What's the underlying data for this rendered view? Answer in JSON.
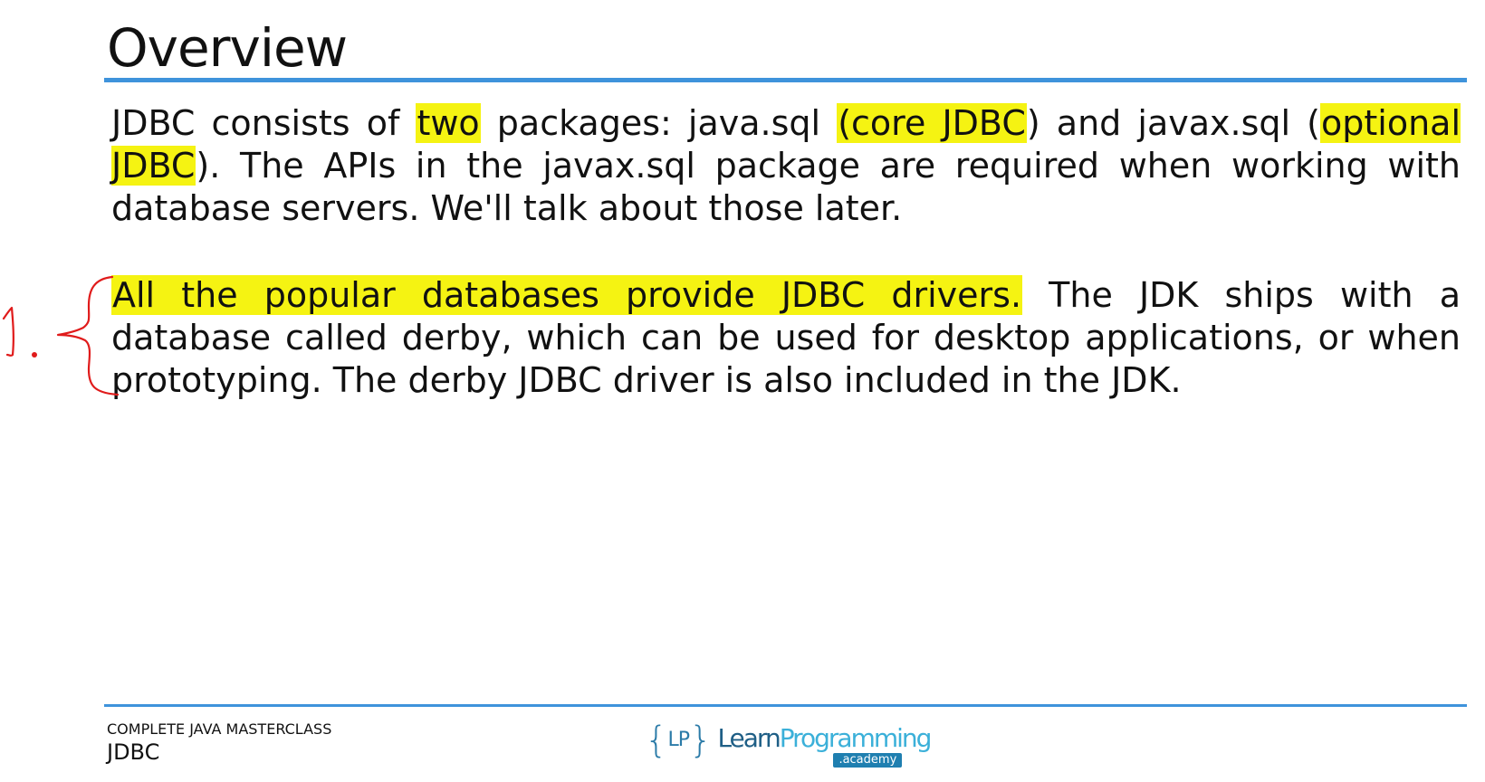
{
  "slide": {
    "title": "Overview"
  },
  "paragraph1": {
    "s1": "JDBC consists of ",
    "h1": "two",
    "s2": " packages: java.sql ",
    "h2": "(core JDBC",
    "s3": ") and javax.sql (",
    "h3": "optional JDBC",
    "s4": "). The APIs in the javax.sql package are required when working with database servers. We'll talk about those later."
  },
  "paragraph2": {
    "h1": "All the popular databases provide JDBC drivers.",
    "s1": " The JDK ships with a database called derby, which can be used for desktop applications, or when prototyping. The derby JDBC driver is also included in the JDK."
  },
  "annotation": {
    "label": "1."
  },
  "footer": {
    "course": "COMPLETE JAVA MASTERCLASS",
    "topic": "JDBC",
    "logo_brace_open": "{",
    "logo_lp": "LP",
    "logo_brace_close": "}",
    "logo_learn": "Learn",
    "logo_programming": "Programming",
    "logo_academy": ".academy"
  },
  "colors": {
    "rule": "#3f93db",
    "highlight": "#f5f312",
    "ink": "#e01b1b"
  }
}
